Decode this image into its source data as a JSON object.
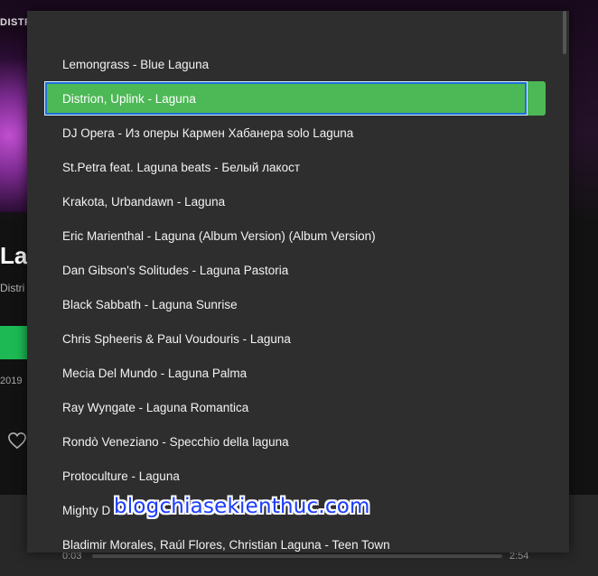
{
  "background": {
    "artist_top": "DISTRIC",
    "title": "La",
    "artist": "Distri",
    "year": "2019",
    "player": {
      "time_elapsed": "0:03",
      "time_total": "2:54"
    }
  },
  "popup": {
    "selected_index": 1,
    "items": [
      {
        "label": "Lemongrass - Blue Laguna"
      },
      {
        "label": "Distrion, Uplink - Laguna"
      },
      {
        "label": "DJ Opera - Из оперы Кармен Хабанера solo Laguna"
      },
      {
        "label": "St.Petra feat. Laguna beats - Белый лакост"
      },
      {
        "label": "Krakota, Urbandawn - Laguna"
      },
      {
        "label": "Eric Marienthal - Laguna (Album Version) (Album Version)"
      },
      {
        "label": "Dan Gibson's Solitudes - Laguna Pastoria"
      },
      {
        "label": "Black Sabbath - Laguna Sunrise"
      },
      {
        "label": "Chris Spheeris & Paul Voudouris - Laguna"
      },
      {
        "label": "Mecia Del Mundo - Laguna Palma"
      },
      {
        "label": "Ray Wyngate - Laguna Romantica"
      },
      {
        "label": "Rondò Veneziano - Specchio della laguna"
      },
      {
        "label": "Protoculture - Laguna"
      },
      {
        "label": "Mighty D"
      },
      {
        "label": "Bladimir Morales, Raúl Flores, Christian Laguna - Teen Town"
      }
    ]
  },
  "watermark": "blogchiasekienthuc.com",
  "colors": {
    "accent": "#4db856",
    "selection_border": "#1b6fd6",
    "popup_bg": "#2e2e2e"
  }
}
